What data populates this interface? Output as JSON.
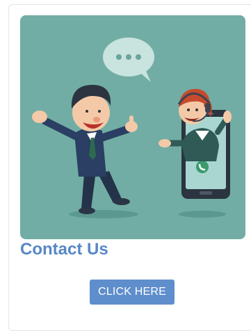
{
  "card": {
    "title": "Contact Us",
    "button_label": "CLICK HERE",
    "illustration_icon": "contact-support-illustration"
  },
  "colors": {
    "title": "#5787c6",
    "button_bg": "#5f8ecc",
    "button_text": "#ffffff",
    "illustration_bg": "#71ada4"
  }
}
